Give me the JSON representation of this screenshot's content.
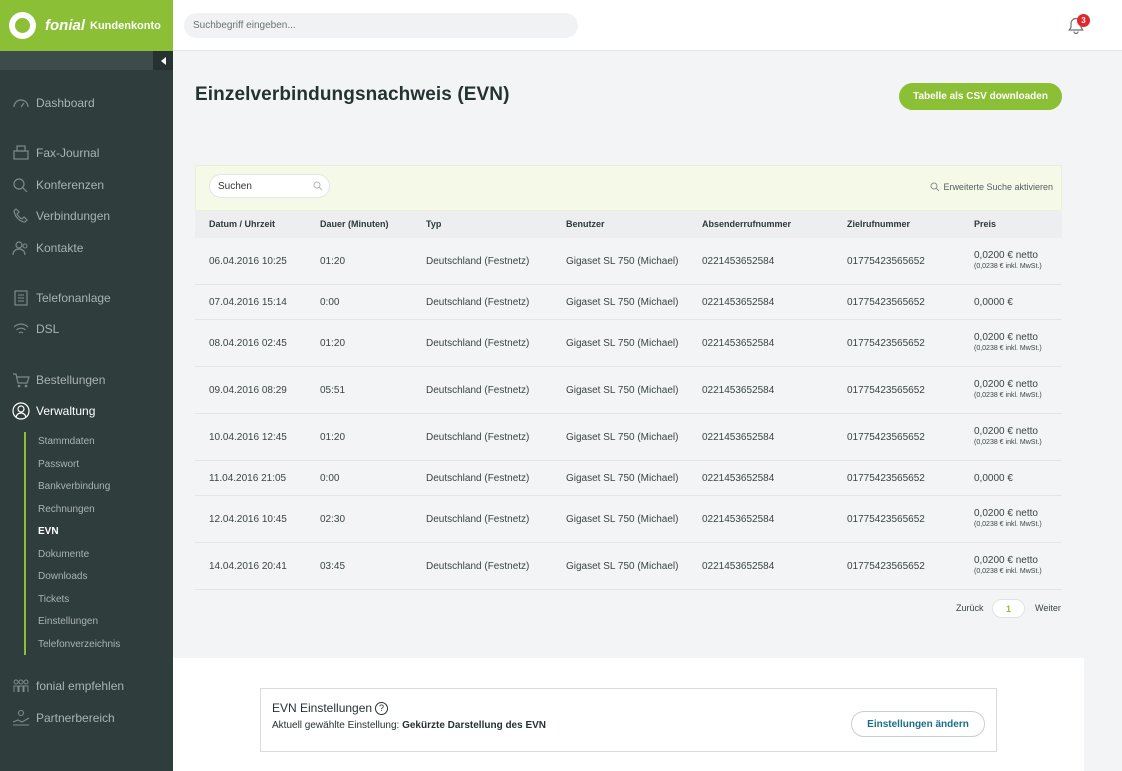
{
  "brand": {
    "name": "fonial",
    "subtitle": "Kundenkonto"
  },
  "search": {
    "placeholder": "Suchbegriff eingeben..."
  },
  "notifications": {
    "count": "3"
  },
  "sidebar": {
    "items": [
      {
        "label": "Dashboard",
        "icon": "gauge-icon"
      },
      {
        "label": "Fax-Journal",
        "icon": "fax-icon"
      },
      {
        "label": "Konferenzen",
        "icon": "conference-icon"
      },
      {
        "label": "Verbindungen",
        "icon": "phone-icon"
      },
      {
        "label": "Kontakte",
        "icon": "contacts-icon"
      },
      {
        "label": "Telefonanlage",
        "icon": "pbx-icon"
      },
      {
        "label": "DSL",
        "icon": "wifi-icon"
      },
      {
        "label": "Bestellungen",
        "icon": "cart-icon"
      },
      {
        "label": "Verwaltung",
        "icon": "user-icon"
      },
      {
        "label": "fonial empfehlen",
        "icon": "people-icon"
      },
      {
        "label": "Partnerbereich",
        "icon": "partner-icon"
      }
    ],
    "subitems": [
      "Stammdaten",
      "Passwort",
      "Bankverbindung",
      "Rechnungen",
      "EVN",
      "Dokumente",
      "Downloads",
      "Tickets",
      "Einstellungen",
      "Telefonverzeichnis"
    ]
  },
  "page": {
    "title": "Einzelverbindungsnachweis (EVN)",
    "csv_button": "Tabelle als CSV downloaden"
  },
  "table": {
    "search_placeholder": "Suchen",
    "advanced_search": "Erweiterte Suche aktivieren",
    "headers": [
      "Datum / Uhrzeit",
      "Dauer (Minuten)",
      "Typ",
      "Benutzer",
      "Absenderrufnummer",
      "Zielrufnummer",
      "Preis"
    ],
    "rows": [
      {
        "date": "06.04.2016 10:25",
        "duration": "01:20",
        "type": "Deutschland (Festnetz)",
        "user": "Gigaset SL 750 (Michael)",
        "from": "0221453652584",
        "to": "01775423565652",
        "price": "0,0200 € netto",
        "price_sub": "(0,0238 € inkl. MwSt.)"
      },
      {
        "date": "07.04.2016 15:14",
        "duration": "0:00",
        "type": "Deutschland (Festnetz)",
        "user": "Gigaset SL 750 (Michael)",
        "from": "0221453652584",
        "to": "01775423565652",
        "price": "0,0000 €",
        "price_sub": ""
      },
      {
        "date": "08.04.2016 02:45",
        "duration": "01:20",
        "type": "Deutschland (Festnetz)",
        "user": "Gigaset SL 750 (Michael)",
        "from": "0221453652584",
        "to": "01775423565652",
        "price": "0,0200 € netto",
        "price_sub": "(0,0238 € inkl. MwSt.)"
      },
      {
        "date": "09.04.2016 08:29",
        "duration": "05:51",
        "type": "Deutschland (Festnetz)",
        "user": "Gigaset SL 750 (Michael)",
        "from": "0221453652584",
        "to": "01775423565652",
        "price": "0,0200 € netto",
        "price_sub": "(0,0238 € inkl. MwSt.)"
      },
      {
        "date": "10.04.2016 12:45",
        "duration": "01:20",
        "type": "Deutschland (Festnetz)",
        "user": "Gigaset SL 750 (Michael)",
        "from": "0221453652584",
        "to": "01775423565652",
        "price": "0,0200 € netto",
        "price_sub": "(0,0238 € inkl. MwSt.)"
      },
      {
        "date": "11.04.2016 21:05",
        "duration": "0:00",
        "type": "Deutschland (Festnetz)",
        "user": "Gigaset SL 750 (Michael)",
        "from": "0221453652584",
        "to": "01775423565652",
        "price": "0,0000 €",
        "price_sub": ""
      },
      {
        "date": "12.04.2016 10:45",
        "duration": "02:30",
        "type": "Deutschland (Festnetz)",
        "user": "Gigaset SL 750 (Michael)",
        "from": "0221453652584",
        "to": "01775423565652",
        "price": "0,0200 € netto",
        "price_sub": "(0,0238 € inkl. MwSt.)"
      },
      {
        "date": "14.04.2016 20:41",
        "duration": "03:45",
        "type": "Deutschland (Festnetz)",
        "user": "Gigaset SL 750 (Michael)",
        "from": "0221453652584",
        "to": "01775423565652",
        "price": "0,0200 € netto",
        "price_sub": "(0,0238 € inkl. MwSt.)"
      }
    ]
  },
  "pagination": {
    "prev": "Zurück",
    "page": "1",
    "next": "Weiter"
  },
  "settings": {
    "title": "EVN Einstellungen",
    "help": "?",
    "current_label": "Aktuell gewählte Einstellung:",
    "current_value": "Gekürzte Darstellung des EVN",
    "button": "Einstellungen ändern"
  },
  "colors": {
    "accent": "#8bbf36",
    "sidebar": "#2f3d3d",
    "link": "#1a6f88"
  }
}
